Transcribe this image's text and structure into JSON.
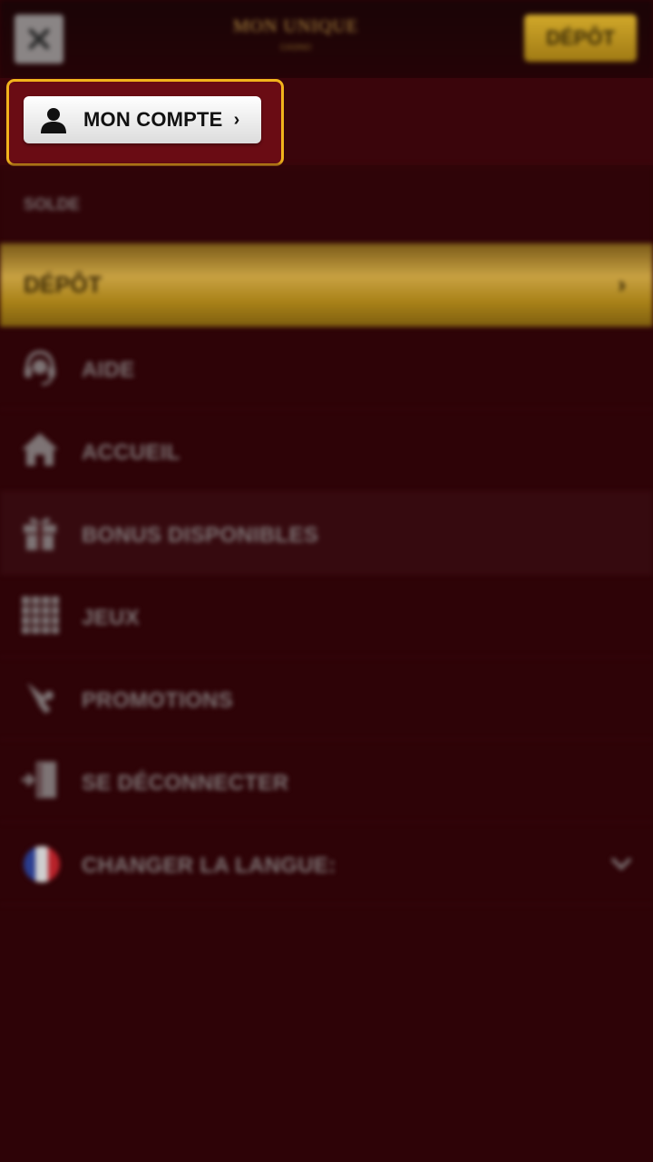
{
  "header": {
    "close_icon": "close-icon",
    "logo_text": "MON UNIQUE",
    "logo_sub": "CASINO",
    "deposit_label": "DÉPÔT"
  },
  "account": {
    "button_label": "MON COMPTE",
    "user_icon": "user-icon",
    "chevron": "›"
  },
  "balance": {
    "label": "SOLDE"
  },
  "deposit_banner": {
    "label": "DÉPÔT",
    "chevron": "›"
  },
  "menu": {
    "items": [
      {
        "label": "AIDE",
        "icon": "headset-icon"
      },
      {
        "label": "ACCUEIL",
        "icon": "home-icon"
      },
      {
        "label": "BONUS DISPONIBLES",
        "icon": "gift-icon"
      },
      {
        "label": "JEUX",
        "icon": "grid-icon"
      },
      {
        "label": "PROMOTIONS",
        "icon": "megaphone-icon"
      },
      {
        "label": "SE DÉCONNECTER",
        "icon": "logout-icon"
      },
      {
        "label": "CHANGER LA LANGUE:",
        "icon": "france-flag-icon"
      }
    ]
  },
  "colors": {
    "background": "#2e0307",
    "accent_gold": "#f2b41c",
    "deposit_gold": "#c8a142"
  }
}
